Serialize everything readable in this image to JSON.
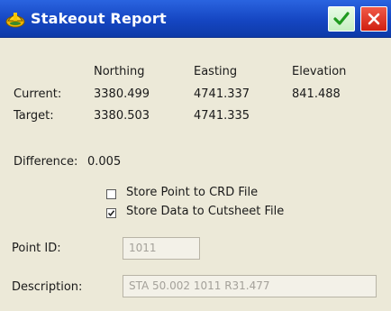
{
  "window": {
    "title": "Stakeout Report",
    "ok_icon": "checkmark-icon",
    "close_icon": "close-icon",
    "app_icon": "survey-helmet-icon"
  },
  "table": {
    "headers": [
      "Northing",
      "Easting",
      "Elevation"
    ],
    "rows": [
      {
        "label": "Current:",
        "northing": "3380.499",
        "easting": "4741.337",
        "elevation": "841.488"
      },
      {
        "label": "Target:",
        "northing": "3380.503",
        "easting": "4741.335",
        "elevation": ""
      }
    ]
  },
  "difference": {
    "label": "Difference:",
    "value": "0.005"
  },
  "options": [
    {
      "label": "Store Point to CRD File",
      "checked": false
    },
    {
      "label": "Store Data to Cutsheet File",
      "checked": true
    }
  ],
  "point_id": {
    "label": "Point ID:",
    "value": "1011"
  },
  "description": {
    "label": "Description:",
    "value": "STA 50.002 1011 R31.477"
  },
  "colors": {
    "titlebar": "#1546c2",
    "background": "#ece9d8",
    "ok": "#c7efc2",
    "close": "#d01f10"
  }
}
